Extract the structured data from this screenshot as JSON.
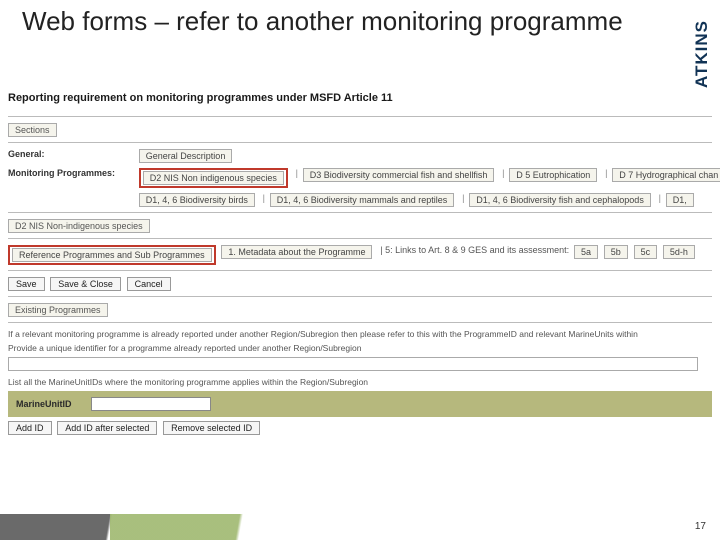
{
  "slide": {
    "title": "Web forms – refer to another monitoring programme",
    "logo": "ATKINS",
    "page_number": "17"
  },
  "form": {
    "heading": "Reporting requirement on monitoring programmes under MSFD Article 11",
    "sections_tab": "Sections",
    "general": {
      "label": "General:",
      "tab": "General Description"
    },
    "monitoring": {
      "label": "Monitoring Programmes:",
      "row1": {
        "d2": "D2 NIS Non indigenous species",
        "d3": "D3 Biodiversity   commercial fish and shellfish",
        "d5": "D 5 Eutrophication",
        "d7": "D 7 Hydrographical chan"
      },
      "row2": {
        "a": "D1, 4, 6 Biodiversity    birds",
        "b": "D1, 4, 6 Biodiversity    mammals and reptiles",
        "c": "D1, 4, 6 Biodiversity   fish and cephalopods",
        "d": "D1,"
      }
    },
    "d2section": {
      "tab": "D2 NIS Non-indigenous species",
      "ref": "Reference Programmes and Sub Programmes",
      "meta": "1. Metadata about the Programme",
      "links_label": "| 5: Links to Art. 8 & 9 GES and its assessment:",
      "t5a": "5a",
      "t5b": "5b",
      "t5c": "5c",
      "t5dh": "5d-h"
    },
    "actions": {
      "save": "Save",
      "save_close": "Save & Close",
      "cancel": "Cancel"
    },
    "existing": {
      "tab": "Existing Programmes",
      "para1": "If a relevant monitoring programme is already reported under another Region/Subregion then please refer to this with the ProgrammeID and relevant MarineUnits within",
      "para2": "Provide a unique identifier for a programme already reported under another Region/Subregion",
      "para3": "List all the MarineUnitIDs where the monitoring programme applies within the Region/Subregion"
    },
    "marine": {
      "label": "MarineUnitID",
      "add": "Add ID",
      "add_after": "Add ID after selected",
      "remove": "Remove selected ID"
    }
  }
}
